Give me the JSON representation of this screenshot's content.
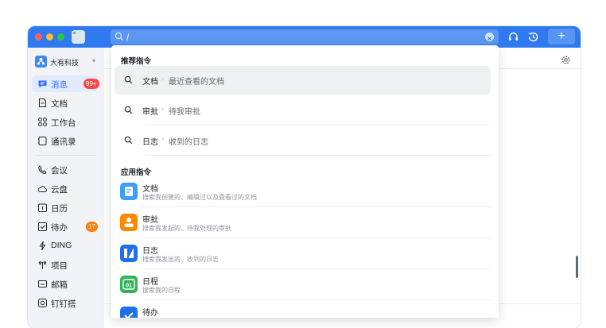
{
  "titlebar": {
    "search_value": "/",
    "accent": "#2f7af0",
    "traffic_lights": [
      "#ff5f57",
      "#febc2e",
      "#28c840"
    ],
    "add_label": "+"
  },
  "sidebar": {
    "org_name": "大有科技",
    "org_caret": "▾",
    "items": [
      {
        "label": "消息",
        "icon": "message-icon",
        "badge": "99+",
        "active": true
      },
      {
        "label": "文档",
        "icon": "document-icon"
      },
      {
        "label": "工作台",
        "icon": "workbench-icon"
      },
      {
        "label": "通讯录",
        "icon": "contacts-icon"
      },
      {
        "label": "会议",
        "icon": "meeting-icon"
      },
      {
        "label": "云盘",
        "icon": "cloud-drive-icon"
      },
      {
        "label": "日历",
        "icon": "calendar-icon"
      },
      {
        "label": "待办",
        "icon": "todo-icon",
        "badge": "17"
      },
      {
        "label": "DING",
        "icon": "ding-icon"
      },
      {
        "label": "项目",
        "icon": "project-icon"
      },
      {
        "label": "邮箱",
        "icon": "mail-icon"
      },
      {
        "label": "钉钉搭",
        "icon": "dingda-icon"
      }
    ]
  },
  "dropdown": {
    "recommended_title": "推荐指令",
    "recommended": [
      {
        "main": "文档",
        "arrow": "›",
        "sub": "最近查看的文档"
      },
      {
        "main": "审批",
        "arrow": "›",
        "sub": "待我审批"
      },
      {
        "main": "日志",
        "arrow": "›",
        "sub": "收到的日志"
      }
    ],
    "apps_title": "应用指令",
    "apps": [
      {
        "title": "文档",
        "desc": "搜索我创建的、编辑过以及查看过的文档",
        "icon": "doc-app-icon",
        "color": "#3ba0f5"
      },
      {
        "title": "审批",
        "desc": "搜索我发起的、待我处理的审批",
        "icon": "approval-app-icon",
        "color": "#ff8800"
      },
      {
        "title": "日志",
        "desc": "搜索我发出的、收到的日志",
        "icon": "log-app-icon",
        "color": "#1f6fe8"
      },
      {
        "title": "日程",
        "desc": "搜索我的日程",
        "icon": "schedule-app-icon",
        "color": "#34b35b",
        "glyph": "01"
      },
      {
        "title": "待办",
        "desc": "",
        "icon": "todo-app-icon",
        "color": "#1f6fe8"
      }
    ]
  }
}
